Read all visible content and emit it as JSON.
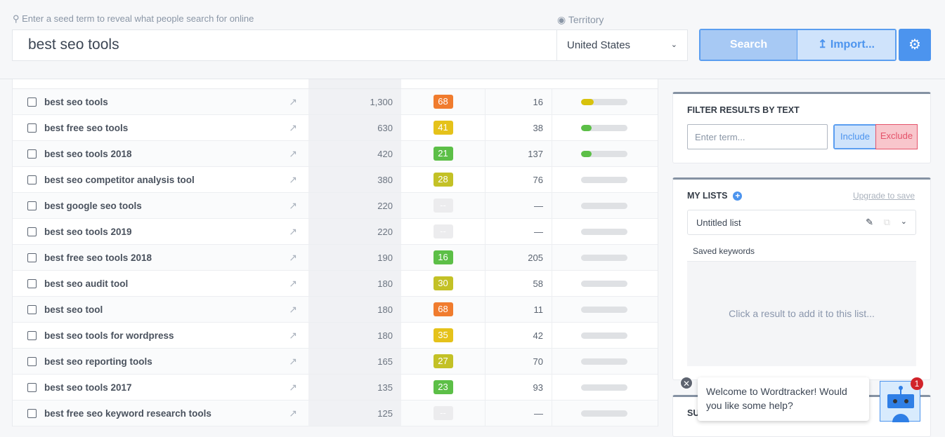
{
  "search": {
    "hint": "Enter a seed term to reveal what people search for online",
    "value": "best seo tools",
    "territory_label": "Territory",
    "territory": "United States",
    "search_label": "Search",
    "import_label": "Import..."
  },
  "colors": {
    "accent": "#4c94ee",
    "orange": "#f07c2e",
    "yellow": "#e5c21a",
    "olive": "#c3c126",
    "green": "#5cbf47",
    "empty": "#ececee"
  },
  "rows": [
    {
      "kw": "best seo tools",
      "vol": "1,300",
      "comp": "68",
      "cc": "orange",
      "n": "16",
      "bar": 0.28,
      "bc": "#d8c20c"
    },
    {
      "kw": "best free seo tools",
      "vol": "630",
      "comp": "41",
      "cc": "yellow",
      "n": "38",
      "bar": 0.22,
      "bc": "#5cbf47"
    },
    {
      "kw": "best seo tools 2018",
      "vol": "420",
      "comp": "21",
      "cc": "green",
      "n": "137",
      "bar": 0.22,
      "bc": "#5cbf47"
    },
    {
      "kw": "best seo competitor analysis tool",
      "vol": "380",
      "comp": "28",
      "cc": "olive",
      "n": "76",
      "bar": 0,
      "bc": ""
    },
    {
      "kw": "best google seo tools",
      "vol": "220",
      "comp": "--",
      "cc": "empty",
      "n": "—",
      "bar": 0,
      "bc": ""
    },
    {
      "kw": "best seo tools 2019",
      "vol": "220",
      "comp": "--",
      "cc": "empty",
      "n": "—",
      "bar": 0,
      "bc": ""
    },
    {
      "kw": "best free seo tools 2018",
      "vol": "190",
      "comp": "16",
      "cc": "green",
      "n": "205",
      "bar": 0,
      "bc": ""
    },
    {
      "kw": "best seo audit tool",
      "vol": "180",
      "comp": "30",
      "cc": "olive",
      "n": "58",
      "bar": 0,
      "bc": ""
    },
    {
      "kw": "best seo tool",
      "vol": "180",
      "comp": "68",
      "cc": "orange",
      "n": "11",
      "bar": 0,
      "bc": ""
    },
    {
      "kw": "best seo tools for wordpress",
      "vol": "180",
      "comp": "35",
      "cc": "yellow",
      "n": "42",
      "bar": 0,
      "bc": ""
    },
    {
      "kw": "best seo reporting tools",
      "vol": "165",
      "comp": "27",
      "cc": "olive",
      "n": "70",
      "bar": 0,
      "bc": ""
    },
    {
      "kw": "best seo tools 2017",
      "vol": "135",
      "comp": "23",
      "cc": "green",
      "n": "93",
      "bar": 0,
      "bc": ""
    },
    {
      "kw": "best free seo keyword research tools",
      "vol": "125",
      "comp": "--",
      "cc": "empty",
      "n": "—",
      "bar": 0,
      "bc": ""
    }
  ],
  "filter": {
    "title": "FILTER RESULTS BY TEXT",
    "placeholder": "Enter term...",
    "include": "Include",
    "exclude": "Exclude"
  },
  "lists": {
    "title": "MY LISTS",
    "upgrade": "Upgrade to save",
    "list_name": "Untitled list",
    "saved_label": "Saved keywords",
    "empty": "Click a result to add it to this list..."
  },
  "next_panel": {
    "title": "SU"
  },
  "chat": {
    "message": "Welcome to Wordtracker! Would you like some help?",
    "badge": "1"
  }
}
